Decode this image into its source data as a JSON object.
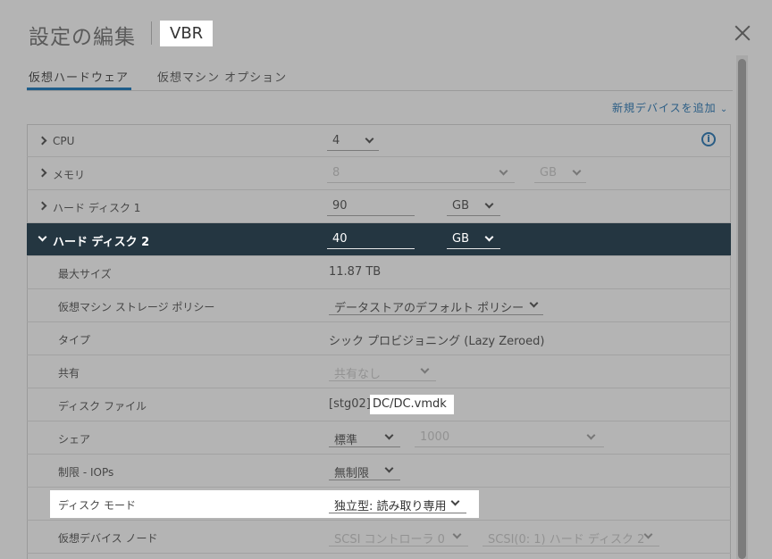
{
  "dialog": {
    "title": "設定の編集",
    "vm_name": "VBR"
  },
  "tabs": [
    {
      "label": "仮想ハードウェア",
      "active": true
    },
    {
      "label": "仮想マシン オプション",
      "active": false
    }
  ],
  "add_device_label": "新規デバイスを追加",
  "hardware": {
    "cpu": {
      "label": "CPU",
      "value": "4"
    },
    "memory": {
      "label": "メモリ",
      "value": "8",
      "unit": "GB"
    },
    "hdd1": {
      "label": "ハード ディスク 1",
      "value": "90",
      "unit": "GB"
    },
    "hdd2": {
      "label": "ハード ディスク 2",
      "value": "40",
      "unit": "GB"
    }
  },
  "details": {
    "max_size": {
      "label": "最大サイズ",
      "value": "11.87 TB"
    },
    "storage_policy": {
      "label": "仮想マシン ストレージ ポリシー",
      "value": "データストアのデフォルト ポリシー"
    },
    "type": {
      "label": "タイプ",
      "value": "シック プロビジョニング (Lazy Zeroed)"
    },
    "sharing": {
      "label": "共有",
      "value": "共有なし"
    },
    "disk_file": {
      "label": "ディスク ファイル",
      "prefix": "[stg02]",
      "path": "DC/DC.vmdk"
    },
    "shares": {
      "label": "シェア",
      "value": "標準",
      "amount": "1000"
    },
    "limit_iops": {
      "label": "制限 - IOPs",
      "value": "無制限"
    },
    "disk_mode": {
      "label": "ディスク モード",
      "value": "独立型: 読み取り専用"
    },
    "device_node": {
      "label": "仮想デバイス ノード",
      "controller": "SCSI コントローラ 0",
      "node": "SCSI(0: 1) ハード ディスク 2"
    }
  },
  "colors": {
    "accent": "#1f5d8a",
    "expanded_row": "#243641",
    "overlay": "#b4b4b4"
  }
}
